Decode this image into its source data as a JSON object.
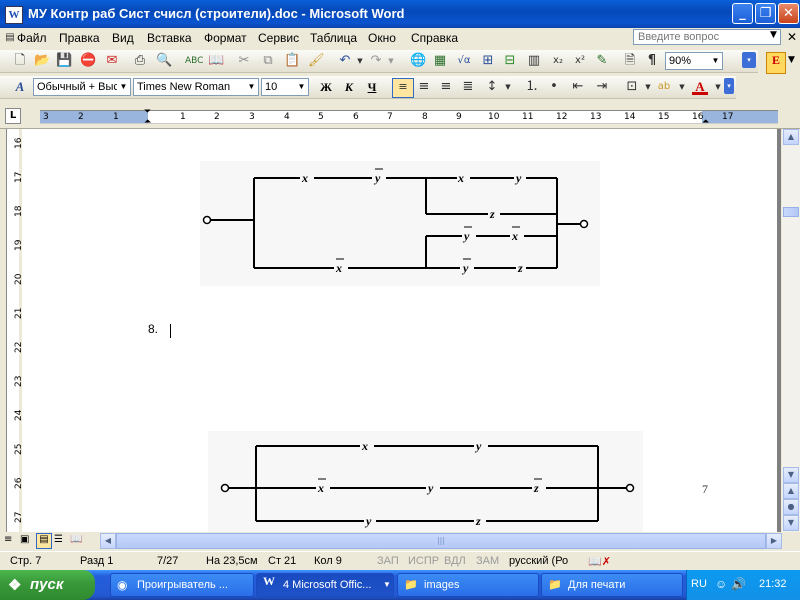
{
  "window": {
    "title": "МУ Контр раб Сист счисл (строители).doc - Microsoft Word"
  },
  "menu": [
    "Файл",
    "Правка",
    "Вид",
    "Вставка",
    "Формат",
    "Сервис",
    "Таблица",
    "Окно",
    "Справка"
  ],
  "ask_box": {
    "placeholder": "Введите вопрос"
  },
  "standard_toolbar": {
    "zoom": "90%"
  },
  "format_toolbar": {
    "style": "Обычный + Выс",
    "font": "Times New Roman",
    "size": "10",
    "bold": "Ж",
    "italic": "К",
    "underline": "Ч"
  },
  "ruler": {
    "h_numbers": [
      "3",
      "2",
      "1",
      "1",
      "2",
      "3",
      "4",
      "5",
      "6",
      "7",
      "8",
      "9",
      "10",
      "11",
      "12",
      "13",
      "14",
      "15",
      "16",
      "17"
    ],
    "v_numbers": [
      "16",
      "17",
      "18",
      "19",
      "20",
      "21",
      "22",
      "23",
      "24",
      "25",
      "26",
      "27"
    ]
  },
  "document": {
    "item_number": "8.",
    "page_number": "7",
    "circuit1": {
      "vars": [
        "x",
        "y",
        "x",
        "y",
        "z",
        "y",
        "x",
        "x",
        "y",
        "z"
      ],
      "negated": [
        false,
        true,
        false,
        false,
        false,
        true,
        true,
        true,
        true,
        false
      ]
    },
    "circuit2": {
      "vars": [
        "x",
        "y",
        "x",
        "y",
        "z",
        "y",
        "z"
      ],
      "negated": [
        false,
        false,
        true,
        false,
        true,
        false,
        false
      ]
    }
  },
  "status": {
    "page": "Стр. 7",
    "section": "Разд 1",
    "pages": "7/27",
    "position": "На 23,5см",
    "line": "Ст 21",
    "column": "Кол 9",
    "rec": "ЗАП",
    "trk": "ИСПР",
    "ext": "ВДЛ",
    "ovr": "ЗАМ",
    "language": "русский (Ро"
  },
  "taskbar": {
    "start": "пуск",
    "tasks": [
      "Проигрыватель ...",
      "4 Microsoft Offic...",
      "images",
      "Для печати"
    ],
    "lang": "RU",
    "time": "21:32"
  }
}
